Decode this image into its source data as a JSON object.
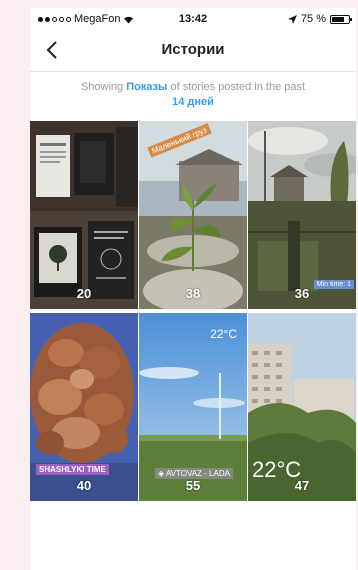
{
  "status_bar": {
    "carrier": "MegaFon",
    "time": "13:42",
    "battery": "75 %",
    "battery_level": 0.75
  },
  "nav": {
    "title": "Истории",
    "back_icon": "chevron-left-icon"
  },
  "filter": {
    "prefix": "Showing ",
    "type_link": "Показы",
    "middle": " of stories posted in the past",
    "period_link": "14 дней"
  },
  "stories": [
    {
      "count": "20"
    },
    {
      "count": "38",
      "sticker": "Маленький груз"
    },
    {
      "count": "36",
      "sticker": "Min time: 1"
    },
    {
      "count": "40",
      "sticker": "SHASHLYKI TIME"
    },
    {
      "count": "55",
      "sticker": "◈ AVTOVAZ - LADA",
      "temp": "22°C"
    },
    {
      "count": "47",
      "temp": "22°C"
    }
  ],
  "colors": {
    "accent": "#3897f0",
    "page_bg": "#fbeef0"
  }
}
